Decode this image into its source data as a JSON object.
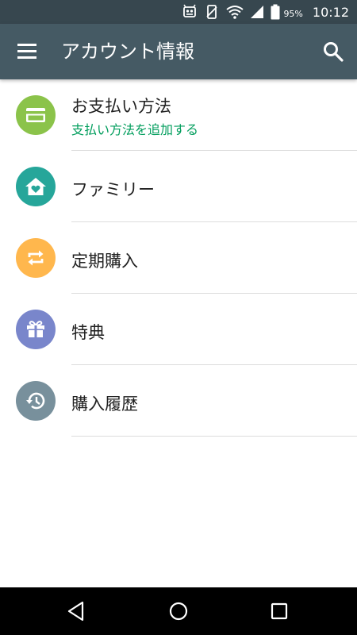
{
  "status_bar": {
    "battery_percent": "95%",
    "time": "10:12",
    "icons": [
      "notification-icon",
      "screen-rotation-icon",
      "wifi-icon",
      "signal-icon",
      "battery-icon"
    ]
  },
  "app_bar": {
    "title": "アカウント情報",
    "menu_icon": "hamburger-menu-icon",
    "search_icon": "search-icon"
  },
  "items": [
    {
      "label": "お支払い方法",
      "sublabel": "支払い方法を追加する",
      "icon": "credit-card-icon",
      "color": "#8bc34a"
    },
    {
      "label": "ファミリー",
      "icon": "family-home-icon",
      "color": "#26a69a"
    },
    {
      "label": "定期購入",
      "icon": "repeat-icon",
      "color": "#ffb74d"
    },
    {
      "label": "特典",
      "icon": "gift-icon",
      "color": "#7986cb"
    },
    {
      "label": "購入履歴",
      "icon": "history-icon",
      "color": "#78909c"
    }
  ],
  "colors": {
    "status_bar": "#37474f",
    "app_bar": "#455a64",
    "sublabel": "#009d5c"
  },
  "nav_bar": {
    "icons": [
      "back-icon",
      "home-icon",
      "recents-icon"
    ]
  }
}
